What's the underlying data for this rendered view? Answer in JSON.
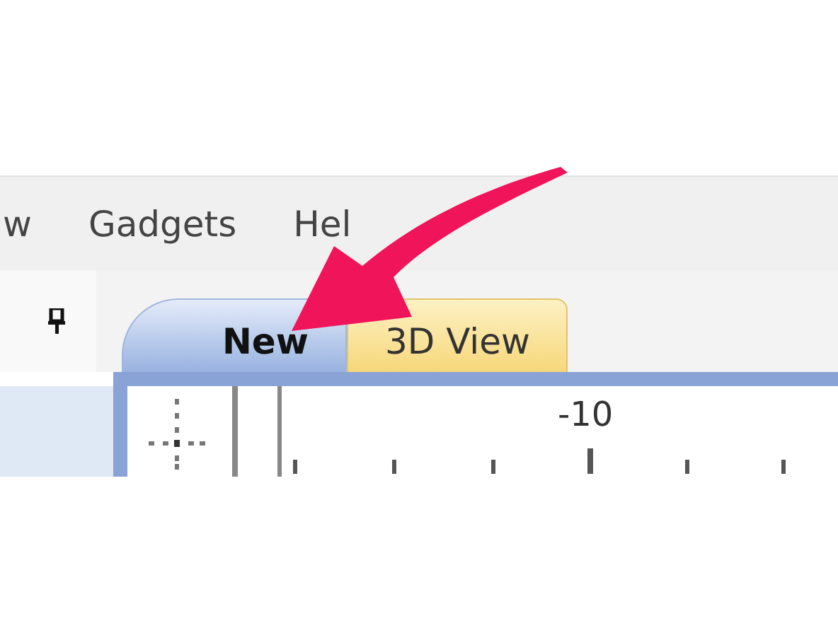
{
  "menu_bar": {
    "items": [
      "w",
      "Gadgets",
      "Hel"
    ]
  },
  "tabs": [
    {
      "label": "New",
      "selected": true
    },
    {
      "label": "3D View",
      "selected": false
    }
  ],
  "ruler": {
    "labels": [
      "-10"
    ]
  }
}
